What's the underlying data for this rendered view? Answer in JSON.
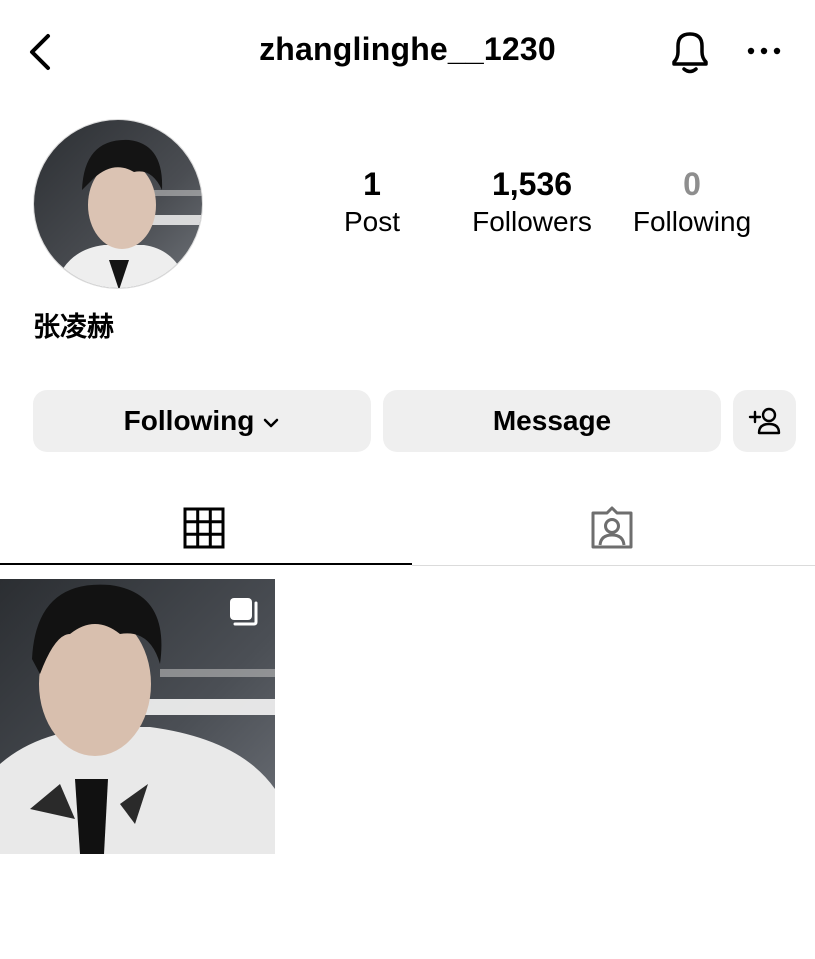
{
  "header": {
    "username": "zhanglinghe__1230",
    "back_icon": "chevron-left-icon",
    "notification_icon": "bell-icon",
    "more_icon": "more-horizontal-icon"
  },
  "profile": {
    "display_name": "张凌赫",
    "avatar_description": "profile photo",
    "stats": {
      "posts_count": "1",
      "posts_label": "Post",
      "followers_count": "1,536",
      "followers_label": "Followers",
      "following_count": "0",
      "following_label": "Following"
    }
  },
  "actions": {
    "following_label": "Following",
    "message_label": "Message",
    "add_user_icon": "add-user-icon"
  },
  "tabs": [
    {
      "name": "posts",
      "icon": "grid-icon",
      "active": true
    },
    {
      "name": "tagged",
      "icon": "tagged-person-icon",
      "active": false
    }
  ],
  "posts": [
    {
      "type": "carousel",
      "indicator_icon": "multiple-images-icon"
    }
  ],
  "colors": {
    "button_bg": "#efefef",
    "muted_text": "#8e8e8e",
    "divider": "#dbdbdb"
  }
}
